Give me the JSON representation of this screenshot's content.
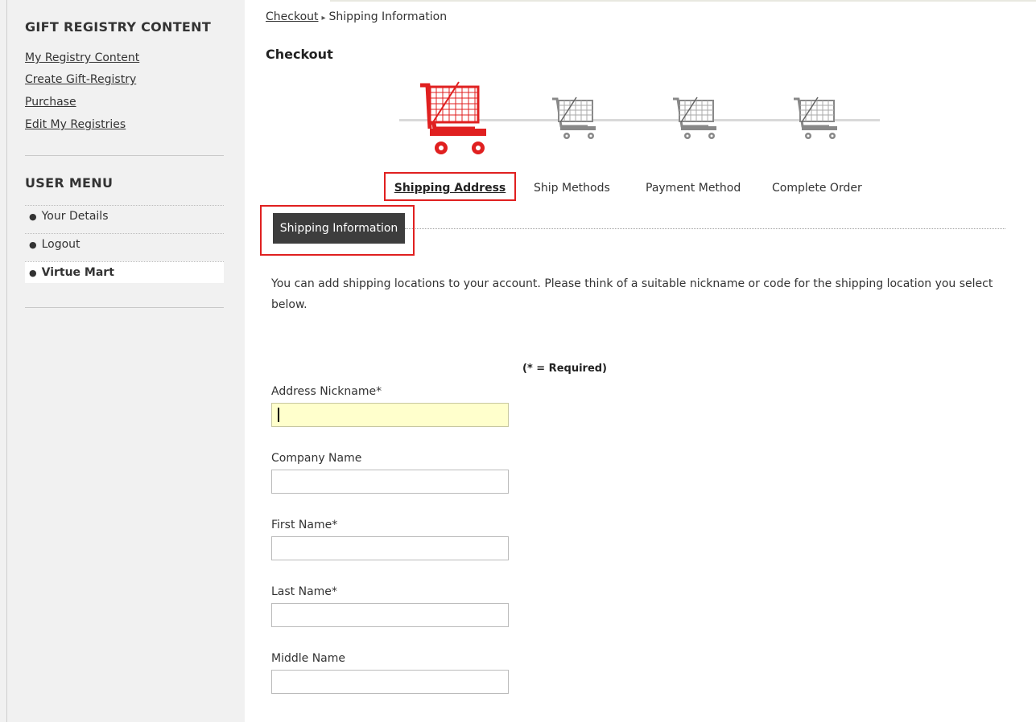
{
  "sidebar": {
    "gift_title": "GIFT REGISTRY CONTENT",
    "gift_links": [
      "My Registry Content",
      "Create Gift-Registry",
      "Purchase",
      "Edit My Registries"
    ],
    "user_title": "USER MENU",
    "user_items": [
      "Your Details",
      "Logout",
      "Virtue Mart"
    ],
    "active_user_item": "Virtue Mart"
  },
  "breadcrumb": {
    "link": "Checkout",
    "current": "Shipping Information"
  },
  "page_title": "Checkout",
  "steps": [
    "Shipping Address",
    "Ship Methods",
    "Payment Method",
    "Complete Order"
  ],
  "active_step": "Shipping Address",
  "tab": {
    "label": "Shipping Information"
  },
  "intro_text": "You can add shipping locations to your account. Please think of a suitable nickname or code for the shipping location you select below.",
  "required_note": "(* = Required)",
  "fields": [
    {
      "label": "Address Nickname*",
      "value": "",
      "focused": true
    },
    {
      "label": "Company Name",
      "value": ""
    },
    {
      "label": "First Name*",
      "value": ""
    },
    {
      "label": "Last Name*",
      "value": ""
    },
    {
      "label": "Middle Name",
      "value": ""
    }
  ],
  "colors": {
    "accent": "#e02020",
    "tab_bg": "#3d3d3d",
    "focused_input": "#ffffcc",
    "cart_inactive": "#888888"
  },
  "icons": {
    "cart": "shopping-cart-icon"
  }
}
